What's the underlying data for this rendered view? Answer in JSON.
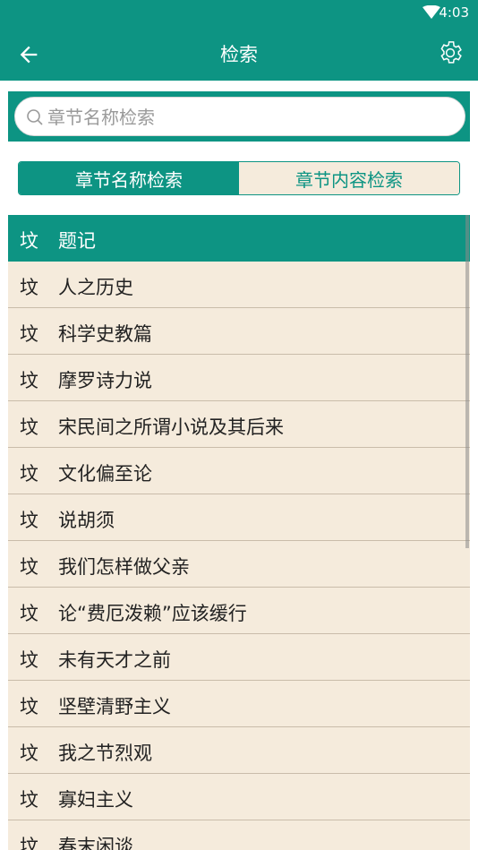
{
  "status_bar": {
    "time": "4:03"
  },
  "app_bar": {
    "title": "检索"
  },
  "search": {
    "placeholder": "章节名称检索",
    "value": ""
  },
  "tabs": [
    {
      "label": "章节名称检索",
      "active": true
    },
    {
      "label": "章节内容检索",
      "active": false
    }
  ],
  "list": {
    "items": [
      {
        "mark": "坟",
        "title": "题记"
      },
      {
        "mark": "坟",
        "title": "人之历史"
      },
      {
        "mark": "坟",
        "title": "科学史教篇"
      },
      {
        "mark": "坟",
        "title": "摩罗诗力说"
      },
      {
        "mark": "坟",
        "title": "宋民间之所谓小说及其后来"
      },
      {
        "mark": "坟",
        "title": "文化偏至论"
      },
      {
        "mark": "坟",
        "title": "说胡须"
      },
      {
        "mark": "坟",
        "title": "我们怎样做父亲"
      },
      {
        "mark": "坟",
        "title": "论“费厄泼赖”应该缓行"
      },
      {
        "mark": "坟",
        "title": "未有天才之前"
      },
      {
        "mark": "坟",
        "title": "坚壁清野主义"
      },
      {
        "mark": "坟",
        "title": "我之节烈观"
      },
      {
        "mark": "坟",
        "title": "寡妇主义"
      },
      {
        "mark": "坟",
        "title": "春末闲谈"
      }
    ]
  },
  "colors": {
    "primary": "#0d9483",
    "row_bg": "#f5ebdc"
  },
  "icons": [
    "wifi-icon",
    "back-arrow-icon",
    "gear-icon",
    "search-icon"
  ]
}
